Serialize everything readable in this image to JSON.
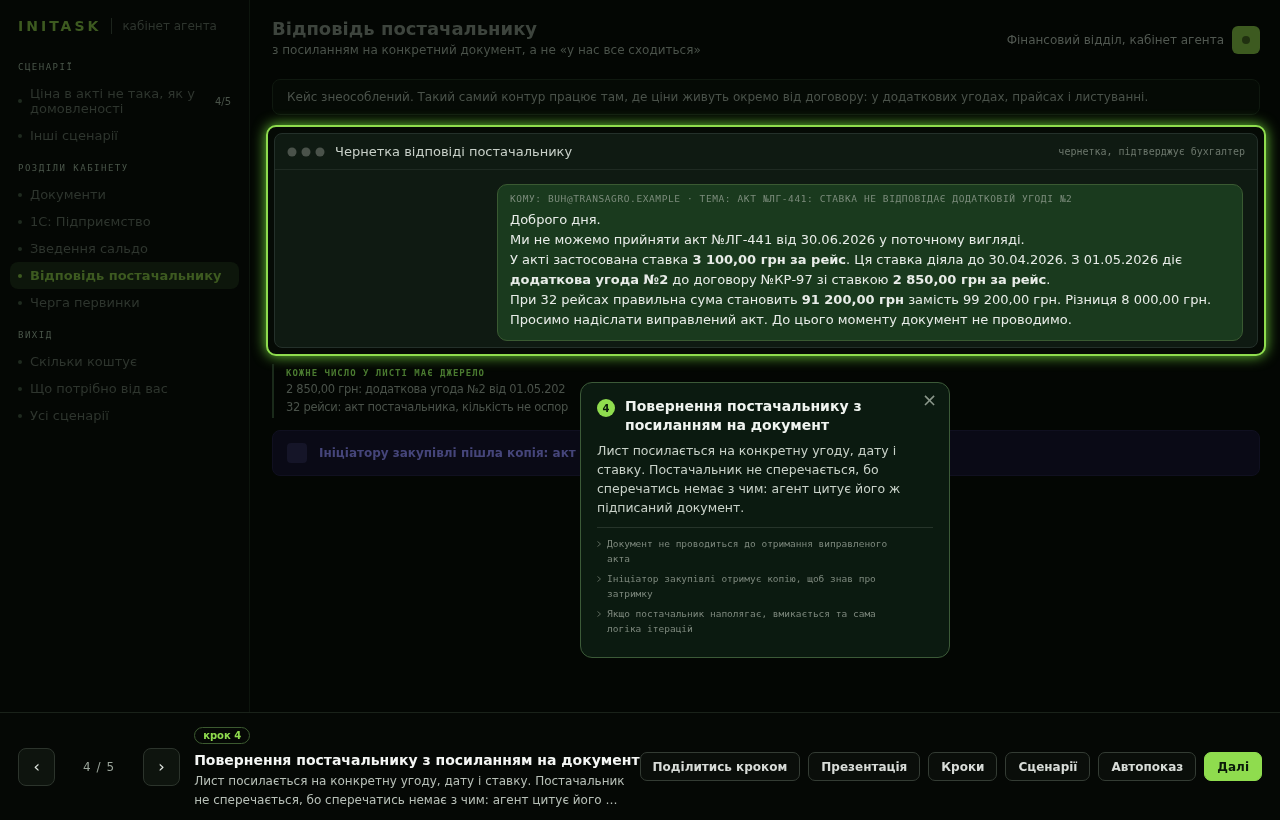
{
  "sidebar": {
    "logo": "INITASK",
    "subtitle": "кабінет агента",
    "sections": [
      {
        "title": "СЦЕНАРІЇ",
        "items": [
          {
            "label": "Ціна в акті не така, як у домовленості",
            "count": "4/5",
            "selected": false
          },
          {
            "label": "Інші сценарії",
            "selected": false
          }
        ]
      },
      {
        "title": "РОЗДІЛИ КАБІНЕТУ",
        "items": [
          {
            "label": "Документи",
            "selected": false
          },
          {
            "label": "1С: Підприємство",
            "selected": false
          },
          {
            "label": "Зведення сальдо",
            "selected": false
          },
          {
            "label": "Відповідь постачальнику",
            "selected": true
          },
          {
            "label": "Черга первинки",
            "selected": false
          }
        ]
      },
      {
        "title": "ВИХІД",
        "items": [
          {
            "label": "Скільки коштує",
            "selected": false
          },
          {
            "label": "Що потрібно від вас",
            "selected": false
          },
          {
            "label": "Усі сценарії",
            "selected": false
          }
        ]
      }
    ]
  },
  "header": {
    "title": "Відповідь постачальнику",
    "subtitle": "з посиланням на конкретний документ, а не «у нас все сходиться»",
    "account": "Фінансовий відділ, кабінет агента"
  },
  "info": "Кейс знеособлений. Такий самий контур працює там, де ціни живуть окремо від договору: у додаткових угодах, прайсах і листуванні.",
  "draft": {
    "title": "Чернетка відповіді постачальнику",
    "status": "чернетка, підтверджує бухгалтер",
    "email_header": "КОМУ: BUH@TRANSAGRO.EXAMPLE · ТЕМА: АКТ №ЛГ-441: СТАВКА НЕ ВІДПОВІДАЄ ДОДАТКОВІЙ УГОДІ №2",
    "lines": [
      "Доброго дня.",
      "Ми не можемо прийняти акт №ЛГ-441 від 30.06.2026 у поточному вигляді.",
      "У акті застосована ставка **3 100,00 грн за рейс**. Ця ставка діяла до 30.04.2026. З 01.05.2026 діє **додаткова угода №2** до договору №КР-97 зі ставкою **2 850,00 грн за рейс**.",
      "При 32 рейсах правильна сума становить **91 200,00 грн** замість 99 200,00 грн. Різниця 8 000,00 грн.",
      "Просимо надіслати виправлений акт. До цього моменту документ не проводимо."
    ]
  },
  "sources": {
    "title": "КОЖНЕ ЧИСЛО У ЛИСТІ МАЄ ДЖЕРЕЛО",
    "lines": [
      "2 850,00 грн: додаткова угода №2 від 01.05.202",
      "32 рейси: акт постачальника, кількість не оспор"
    ]
  },
  "notice": "Ініціатору закупівлі пішла копія: акт",
  "popover": {
    "badge": "4",
    "title": "Повернення постачальнику з посиланням на документ",
    "body": "Лист посилається на конкретну угоду, дату і ставку. Постачальник не сперечається, бо сперечатись немає з чим: агент цитує його ж підписаний документ.",
    "close": "×",
    "bullets": [
      "Документ не проводиться до отримання виправленого акта",
      "Ініціатор закупівлі отримує копію, щоб знав про затримку",
      "Якщо постачальник наполягає, вмикається та сама логіка ітерацій"
    ]
  },
  "footer": {
    "prev": "‹",
    "next": "›",
    "counter": "4 / 5",
    "step": "крок 4",
    "title": "Повернення постачальнику з посиланням на документ",
    "desc": "Лист посилається на конкретну угоду, дату і ставку. Постачальник не сперечається, бо сперечатись немає з чим: агент цитує його …",
    "buttons": [
      {
        "label": "Поділитись кроком",
        "kind": "outline"
      },
      {
        "label": "Презентація",
        "kind": "outline"
      },
      {
        "label": "Кроки",
        "kind": "outline"
      },
      {
        "label": "Сценарії",
        "kind": "outline"
      },
      {
        "label": "Автопоказ",
        "kind": "outline"
      },
      {
        "label": "Далі",
        "kind": "primary"
      }
    ]
  }
}
